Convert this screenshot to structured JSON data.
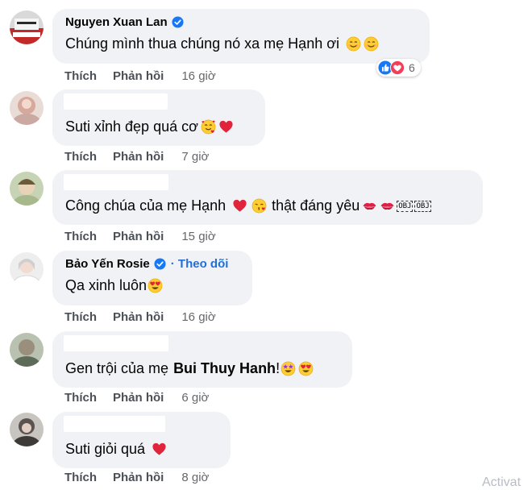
{
  "actions": {
    "like": "Thích",
    "reply": "Phản hồi"
  },
  "comments": [
    {
      "author": "Nguyen Xuan Lan",
      "verified": true,
      "text": "Chúng mình thua chúng nó xa mẹ Hạnh ơi",
      "emojis": [
        "smiling-face-icon",
        "smiling-face-icon"
      ],
      "time": "16 giờ",
      "reactions": {
        "icons": [
          "like-reaction-icon",
          "love-reaction-icon"
        ],
        "count": "6"
      }
    },
    {
      "author": "",
      "text": "Suti xỉnh đẹp quá cơ",
      "emojis": [
        "smiling-face-with-hearts-icon",
        "red-heart-icon"
      ],
      "time": "7 giờ"
    },
    {
      "author": "",
      "text": "Công chúa của mẹ Hạnh",
      "text_after": "thật đáng yêu",
      "emojis": [
        "red-heart-icon",
        "face-blowing-kiss-icon"
      ],
      "emojis_after": [
        "kiss-mark-icon",
        "kiss-mark-icon"
      ],
      "obj_labels": [
        "OBJ",
        "OBJ"
      ],
      "time": "15 giờ"
    },
    {
      "author": "Bảo Yến Rosie",
      "verified": true,
      "follow": "· Theo dõi",
      "text": "Qa xinh luôn",
      "emojis": [
        "heart-eyes-icon"
      ],
      "time": "16 giờ"
    },
    {
      "author": "",
      "text": "Gen trội của mẹ",
      "mention": "Bui Thuy Hanh",
      "text_after": "!",
      "emojis": [
        "star-struck-icon",
        "heart-eyes-icon"
      ],
      "time": "6 giờ"
    },
    {
      "author": "",
      "text": "Suti giỏi quá",
      "emojis": [
        "red-heart-icon"
      ],
      "time": "8 giờ"
    }
  ],
  "watermark": "Activat",
  "colors": {
    "bubble": "#f0f2f5",
    "link_blue": "#216fdb",
    "action_gray": "#4b4f56",
    "time_gray": "#65676b"
  }
}
